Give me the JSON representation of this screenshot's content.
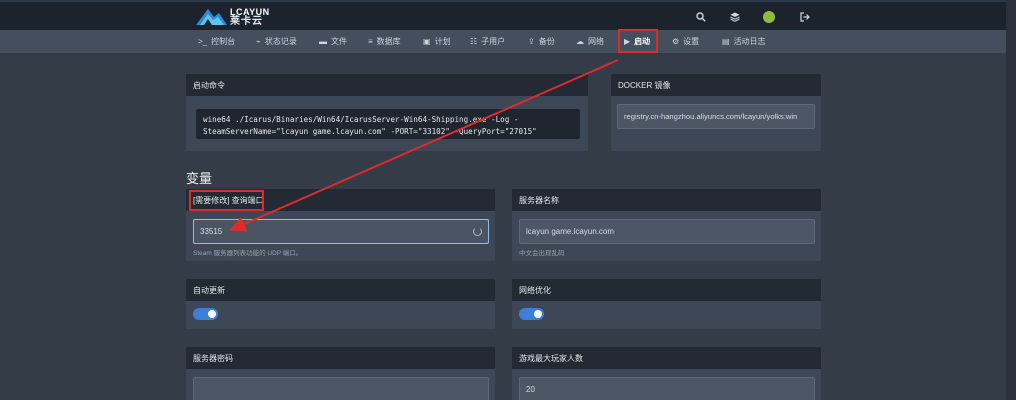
{
  "brand": {
    "name_en": "LCAYUN",
    "name_cn": "莱卡云"
  },
  "topbar": {
    "icons": [
      "search-icon",
      "layers-icon",
      "avatar",
      "logout-icon"
    ],
    "search_glyph": "⚲",
    "layers_glyph": "≋",
    "logout_glyph": "⇥"
  },
  "nav": {
    "items": [
      {
        "label": "控制台",
        "icon": ">_"
      },
      {
        "label": "状态记录",
        "icon": "⌁"
      },
      {
        "label": "文件",
        "icon": "▬"
      },
      {
        "label": "数据库",
        "icon": "≡"
      },
      {
        "label": "计划",
        "icon": "▣"
      },
      {
        "label": "子用户",
        "icon": "☷"
      },
      {
        "label": "备份",
        "icon": "⇪"
      },
      {
        "label": "网络",
        "icon": "☁"
      },
      {
        "label": "启动",
        "icon": "▶"
      },
      {
        "label": "设置",
        "icon": "⚙"
      },
      {
        "label": "活动日志",
        "icon": "▤"
      }
    ],
    "active_index": 8
  },
  "startup": {
    "title": "启动命令",
    "command_line1": "wine64 ./Icarus/Binaries/Win64/IcarusServer-Win64-Shipping.exe -Log -",
    "command_line2": "SteamServerName=\"lcayun game.lcayun.com\" -PORT=\"33102\" -QueryPort=\"27015\""
  },
  "docker": {
    "title": "DOCKER 镜像",
    "value": "registry.cn-hangzhou.aliyuncs.com/lcayun/yolks:win"
  },
  "variables": {
    "section_title": "变量",
    "query_port": {
      "label": "[需要修改] 查询端口",
      "value": "33515",
      "help": "Steam 服务器列表功能的 UDP 端口。"
    },
    "server_name": {
      "label": "服务器名称",
      "value": "lcayun game.lcayun.com",
      "help": "中文会出现乱码"
    },
    "auto_update": {
      "label": "自动更新",
      "enabled": true
    },
    "network_opt": {
      "label": "网络优化",
      "enabled": true
    },
    "server_password": {
      "label": "服务器密码",
      "value": ""
    },
    "max_players": {
      "label": "游戏最大玩家人数",
      "value": "20"
    }
  },
  "colors": {
    "accent": "#3a7fd8",
    "highlight": "#e02b2b",
    "background": "#343c48"
  }
}
